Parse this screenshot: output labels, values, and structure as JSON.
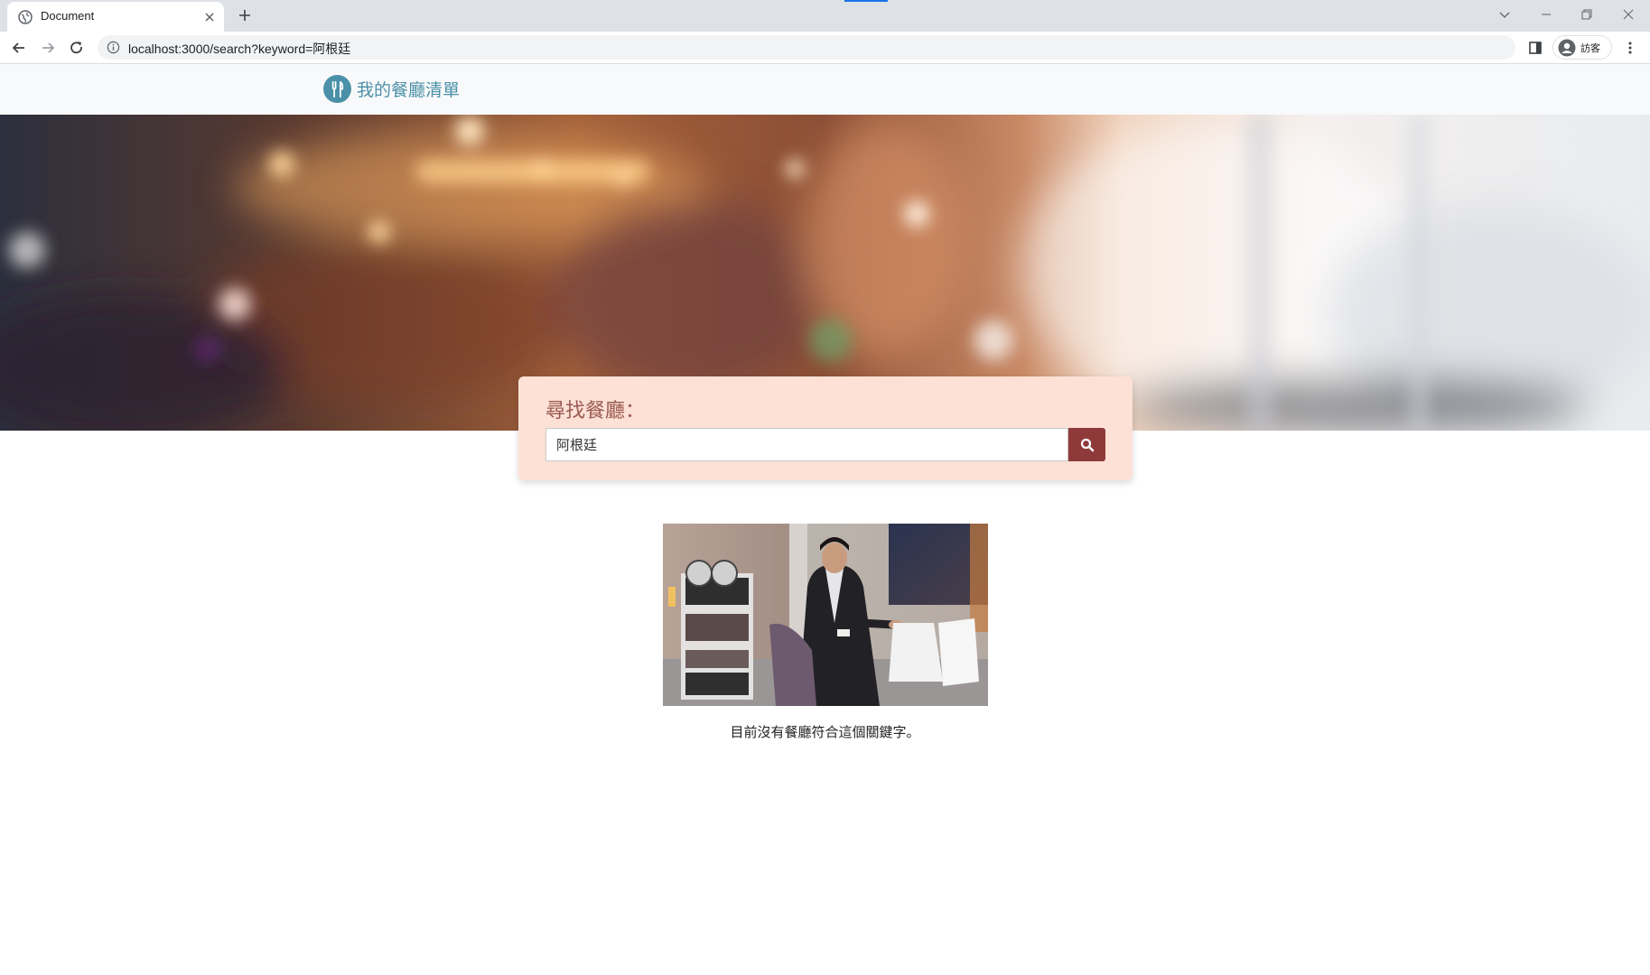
{
  "browser": {
    "tab_title": "Document",
    "url": "localhost:3000/search?keyword=阿根廷",
    "profile_label": "訪客"
  },
  "navbar": {
    "brand_text": "我的餐廳清單"
  },
  "search": {
    "title": "尋找餐廳：",
    "value": "阿根廷"
  },
  "results": {
    "empty_message": "目前沒有餐廳符合這個關鍵字。"
  },
  "colors": {
    "brand": "#4a90a8",
    "card_bg": "#fde1d6",
    "search_button": "#8f3a3a",
    "title_text": "#9a5a52"
  },
  "icons": {
    "brand_logo": "utensils-icon",
    "search_button": "search-icon"
  }
}
